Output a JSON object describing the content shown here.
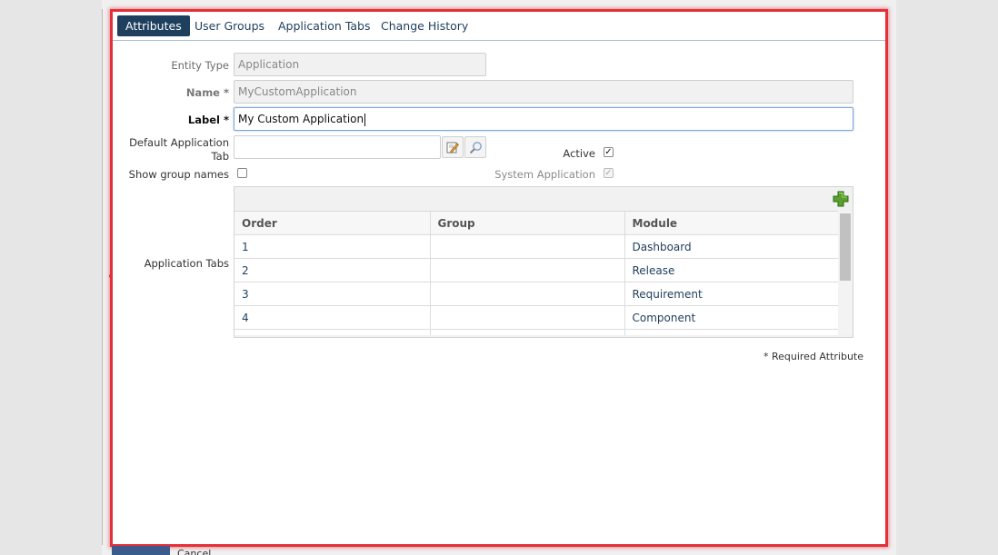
{
  "tabs": [
    {
      "label": "Attributes",
      "active": true
    },
    {
      "label": "User Groups",
      "active": false
    },
    {
      "label": "Application Tabs",
      "active": false
    },
    {
      "label": "Change History",
      "active": false
    }
  ],
  "form": {
    "entity_type": {
      "label": "Entity Type",
      "value": "Application"
    },
    "name": {
      "label": "Name *",
      "value": "MyCustomApplication"
    },
    "label": {
      "label": "Label *",
      "value": "My Custom Application"
    },
    "default_tab": {
      "label_line1": "Default Application",
      "label_line2": "Tab",
      "value": ""
    },
    "active": {
      "label": "Active",
      "checked": true
    },
    "show_group_names": {
      "label": "Show group names",
      "checked": false
    },
    "system_application": {
      "label": "System Application",
      "checked": true,
      "disabled": true
    },
    "application_tabs_label": "Application Tabs"
  },
  "grid": {
    "columns": [
      "Order",
      "Group",
      "Module"
    ],
    "rows": [
      {
        "order": "1",
        "group": "",
        "module": "Dashboard"
      },
      {
        "order": "2",
        "group": "",
        "module": "Release"
      },
      {
        "order": "3",
        "group": "",
        "module": "Requirement"
      },
      {
        "order": "4",
        "group": "",
        "module": "Component"
      }
    ]
  },
  "required_note": "* Required Attribute",
  "footer": {
    "cancel_label": "Cancel"
  },
  "colors": {
    "accent": "#1e3f5e",
    "highlight_border": "#e4303a",
    "link": "#1f3e5b"
  }
}
